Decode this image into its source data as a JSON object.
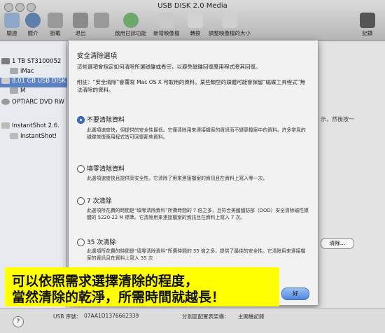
{
  "window": {
    "title": "USB DISK 2.0 Media"
  },
  "toolbar": {
    "items": [
      "驗證",
      "簡介",
      "掛載",
      "退出",
      "啟用日誌功能",
      "新增映像檔",
      "轉換",
      "調整映像檔的大小"
    ],
    "log_label": "記錄"
  },
  "sidebar": {
    "items": [
      "1 TB ST3100052",
      "iMac",
      "8.01 GB USB DISK",
      "M",
      "OPTIARC DVD RW",
      "InstantShot 2.6.",
      "InstantShot!"
    ]
  },
  "background": {
    "right_text_1": "示，然後按一",
    "erase_button": "清除…"
  },
  "sheet": {
    "heading": "安全清除選項",
    "intro": "這些選項會指定如何清除所選磁碟或卷宗，以避免磁碟回復應用程式將其回復。",
    "note": "附註：“安全清除”會覆寫 Mac OS X 可取用的資料。某些類型的媒體可能會保留“磁碟工具程式”無法清除的資料。",
    "options": [
      {
        "label": "不要清除資料",
        "selected": true,
        "desc": "此選項速度快，但提供的安全性最低。它僅清除用來連接檔案的資訊而不變更檔案中的資料。許多常見的磁碟恢復應用程式皆可回復那些資料。"
      },
      {
        "label": "填零清除資料",
        "selected": false,
        "desc": "此選項速度快且提供高安全性。它清除了用來連接檔案的資訊且在資料上寫入零一次。"
      },
      {
        "label": "7 次清除",
        "selected": false,
        "desc": "此選項所花費的時間是“填零清除資料”所費時間的 7 倍之多，且符合美國國防部（DOD）安全清除磁性媒體的 5220-22 M 標準。它清除用來連接檔案的資訊且在資料上寫入 7 次。"
      },
      {
        "label": "35 次清除",
        "selected": false,
        "desc": "此選項所花費的時間是“填零清除資料”所費時間的 35 倍之多，提供了最佳的安全性。它清除用來連接檔案的資訊且在資料上寫入 35 次"
      }
    ],
    "ok_button": "好"
  },
  "caption": {
    "line1": "可以依照需求選擇清除的程度，",
    "line2": "當然清除的乾淨，所需時間就越長！"
  },
  "status": {
    "usb_serial_label": "USB 序號：",
    "usb_serial_value": "07AA1D1376662339",
    "partition_label": "分割區配置表架構：",
    "partition_value": "主開機記錄"
  }
}
